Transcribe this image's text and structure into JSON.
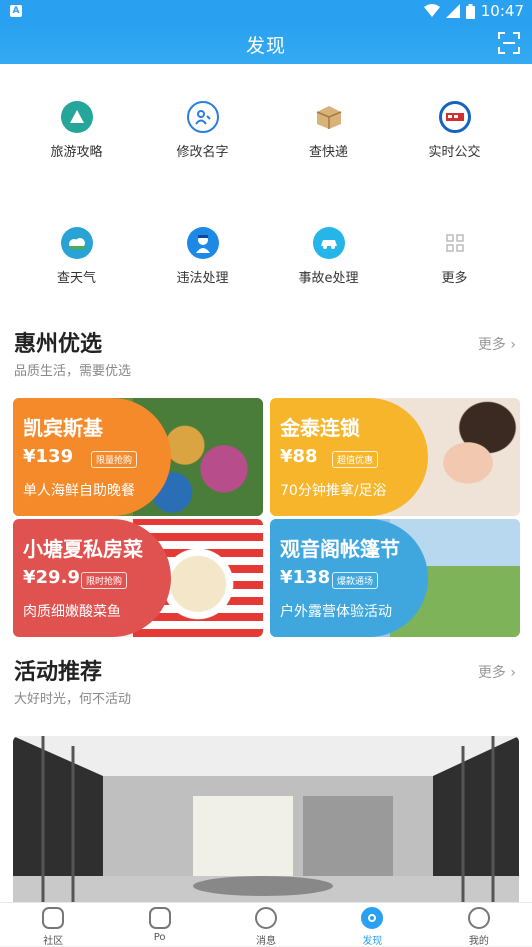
{
  "status": {
    "app_badge": "A",
    "time": "10:47"
  },
  "header": {
    "title": "发现"
  },
  "tools": [
    {
      "label": "旅游攻略",
      "icon": "travel-guide-icon",
      "color": "#26a69a"
    },
    {
      "label": "修改名字",
      "icon": "edit-name-icon",
      "color": "#2a7de1"
    },
    {
      "label": "查快递",
      "icon": "package-icon",
      "color": "#c9a063"
    },
    {
      "label": "实时公交",
      "icon": "bus-icon",
      "color": "#d32f2f"
    },
    {
      "label": "查天气",
      "icon": "weather-icon",
      "color": "#29a3d6"
    },
    {
      "label": "违法处理",
      "icon": "police-icon",
      "color": "#1e88e5"
    },
    {
      "label": "事故e处理",
      "icon": "accident-icon",
      "color": "#26b5e8"
    },
    {
      "label": "更多",
      "icon": "more-grid-icon",
      "color": "#bbbbbb"
    }
  ],
  "section1": {
    "title": "惠州优选",
    "subtitle": "品质生活，需要优选",
    "more": "更多"
  },
  "deals": [
    {
      "name": "凯宾斯基",
      "price": "¥139",
      "tag": "限量抢购",
      "desc": "单人海鲜自助晚餐",
      "color": "#f58a2a"
    },
    {
      "name": "金泰连锁",
      "price": "¥88",
      "tag": "超值优惠",
      "desc": "70分钟推拿/足浴",
      "color": "#f6b52a"
    },
    {
      "name": "小塘夏私房菜",
      "price": "¥29.9",
      "tag": "限时抢购",
      "desc": "肉质细嫩酸菜鱼",
      "color": "#e0524f"
    },
    {
      "name": "观音阁帐篷节",
      "price": "¥138",
      "tag": "爆款通场",
      "desc": "户外露营体验活动",
      "color": "#3fa7dd"
    }
  ],
  "section2": {
    "title": "活动推荐",
    "subtitle": "大好时光，何不活动",
    "more": "更多"
  },
  "tabbar": [
    {
      "label": "社区",
      "icon": "community-icon"
    },
    {
      "label": "Po",
      "icon": "post-icon"
    },
    {
      "label": "消息",
      "icon": "message-icon"
    },
    {
      "label": "发现",
      "icon": "discover-icon",
      "active": true
    },
    {
      "label": "我的",
      "icon": "profile-icon"
    }
  ]
}
